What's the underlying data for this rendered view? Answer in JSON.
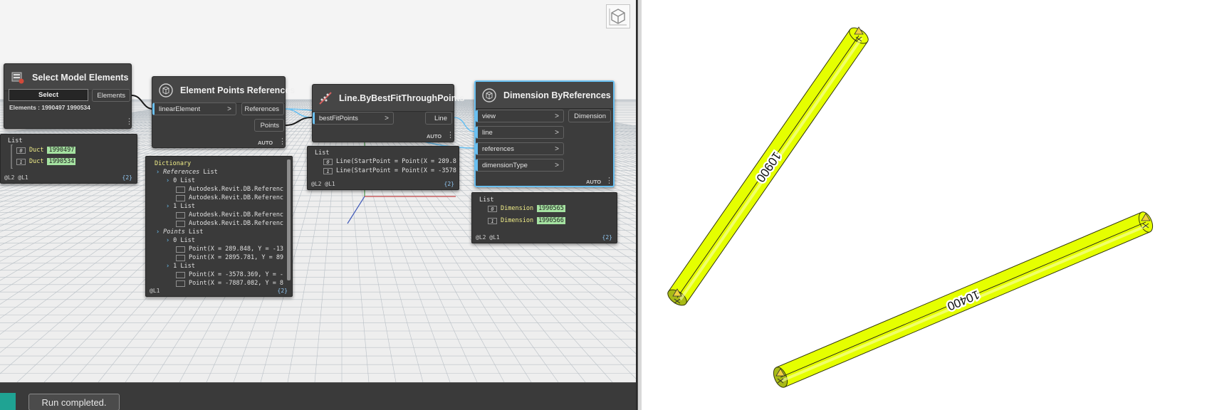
{
  "canvas": {
    "view_cube_icon": "3d-cube-icon",
    "nodes": {
      "select_model_elements": {
        "title": "Select Model Elements",
        "select_button": "Select",
        "elements_text": "Elements : 1990497 1990534",
        "output_port": "Elements",
        "preview": {
          "header": "List",
          "items": [
            {
              "index": "0",
              "key": "Duct",
              "value": "1990497"
            },
            {
              "index": "1",
              "key": "Duct",
              "value": "1990534"
            }
          ],
          "footer": "@L2 @L1",
          "count": "{2}"
        }
      },
      "element_points_references": {
        "title": "Element Points References",
        "input_port": "linearElement",
        "output_ports": [
          "References",
          "Points"
        ],
        "lacing": "AUTO",
        "preview": {
          "header": "Dictionary",
          "lines": [
            {
              "text": "References",
              "suffix": "List"
            },
            {
              "text": "0 List"
            },
            {
              "text": "Autodesk.Revit.DB.Referenc"
            },
            {
              "text": "Autodesk.Revit.DB.Referenc"
            },
            {
              "text": "1 List"
            },
            {
              "text": "Autodesk.Revit.DB.Referenc"
            },
            {
              "text": "Autodesk.Revit.DB.Referenc"
            },
            {
              "text": "Points",
              "suffix": "List"
            },
            {
              "text": "0 List"
            },
            {
              "text": "Point(X = 289.848, Y = -13"
            },
            {
              "text": "Point(X = 2895.781, Y = 89"
            },
            {
              "text": "1 List"
            },
            {
              "text": "Point(X = -3578.369, Y = -"
            },
            {
              "text": "Point(X = -7887.082, Y = 8"
            }
          ],
          "footer": "@L1",
          "count": "{2}"
        }
      },
      "line_best_fit": {
        "title": "Line.ByBestFitThroughPoints",
        "input_port": "bestFitPoints",
        "output_port": "Line",
        "lacing": "AUTO",
        "preview": {
          "header": "List",
          "items": [
            {
              "index": "0",
              "value": "Line(StartPoint = Point(X = 289.8"
            },
            {
              "index": "1",
              "value": "Line(StartPoint = Point(X = -3578"
            }
          ],
          "footer": "@L2 @L1",
          "count": "{2}"
        }
      },
      "dimension_by_references": {
        "title": "Dimension ByReferences",
        "input_ports": [
          "view",
          "line",
          "references",
          "dimensionType"
        ],
        "output_port": "Dimension",
        "lacing": "AUTO",
        "preview": {
          "header": "List",
          "items": [
            {
              "index": "0",
              "key": "Dimension",
              "value": "1990565"
            },
            {
              "index": "1",
              "key": "Dimension",
              "value": "1990566"
            }
          ],
          "footer": "@L2 @L1",
          "count": "{2}"
        }
      }
    }
  },
  "status_bar": {
    "run_status": "Run completed."
  },
  "revit_view": {
    "duct_color": "#e5ff00",
    "dimensions": [
      "10900",
      "10400"
    ]
  }
}
